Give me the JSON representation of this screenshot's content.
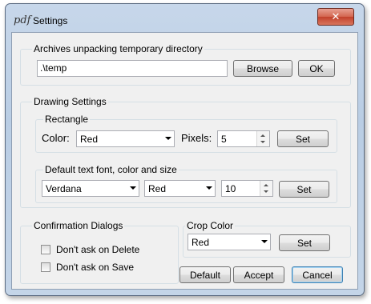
{
  "window": {
    "title": "Settings",
    "close_glyph": "✕",
    "app_icon": "pdf-icon",
    "app_icon_glyph": "pdf"
  },
  "archives": {
    "label": "Archives unpacking temporary directory",
    "path_value": ".\\temp",
    "browse_label": "Browse",
    "ok_label": "OK"
  },
  "drawing": {
    "label": "Drawing Settings",
    "rectangle": {
      "label": "Rectangle",
      "color_label": "Color:",
      "color_value": "Red",
      "pixels_label": "Pixels:",
      "pixels_value": "5",
      "set_label": "Set"
    },
    "text": {
      "label": "Default text font, color and size",
      "font_value": "Verdana",
      "color_value": "Red",
      "size_value": "10",
      "set_label": "Set"
    }
  },
  "confirmation": {
    "label": "Confirmation Dialogs",
    "delete_label": "Don't ask on Delete",
    "delete_checked": false,
    "save_label": "Don't ask on Save",
    "save_checked": false
  },
  "crop": {
    "label": "Crop Color",
    "color_value": "Red",
    "set_label": "Set"
  },
  "footer": {
    "default_label": "Default",
    "accept_label": "Accept",
    "cancel_label": "Cancel"
  }
}
